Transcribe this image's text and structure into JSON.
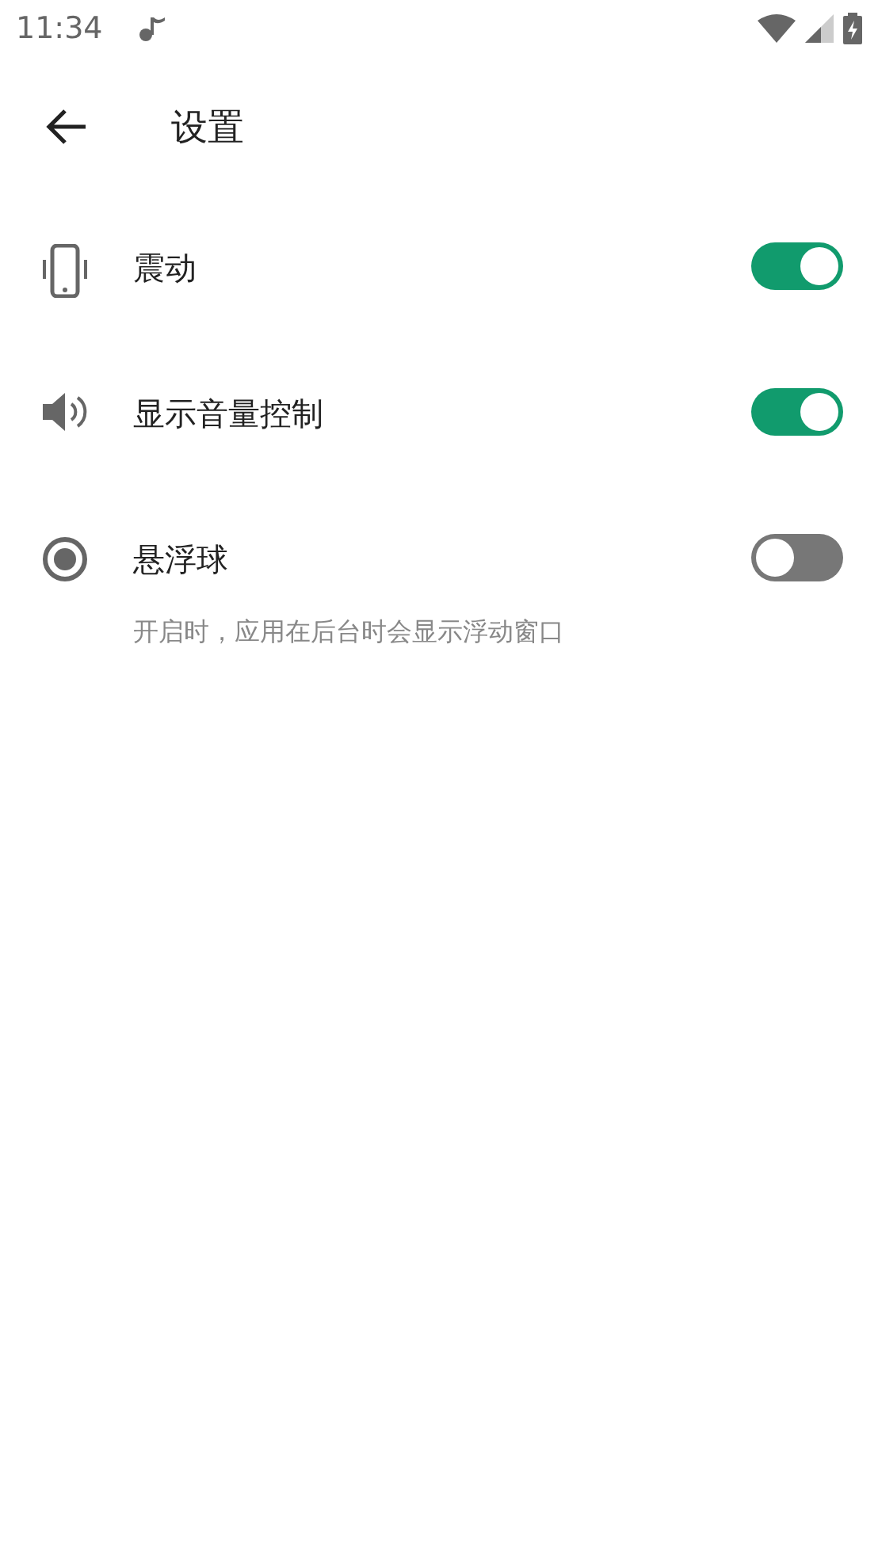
{
  "status_bar": {
    "time": "11:34"
  },
  "toolbar": {
    "title": "设置"
  },
  "settings": [
    {
      "kind": "vibrate",
      "label": "震动",
      "on": true
    },
    {
      "kind": "volume",
      "label": "显示音量控制",
      "on": true
    },
    {
      "kind": "radio",
      "label": "悬浮球",
      "on": false,
      "summary": "开启时，应用在后台时会显示浮动窗口"
    }
  ]
}
